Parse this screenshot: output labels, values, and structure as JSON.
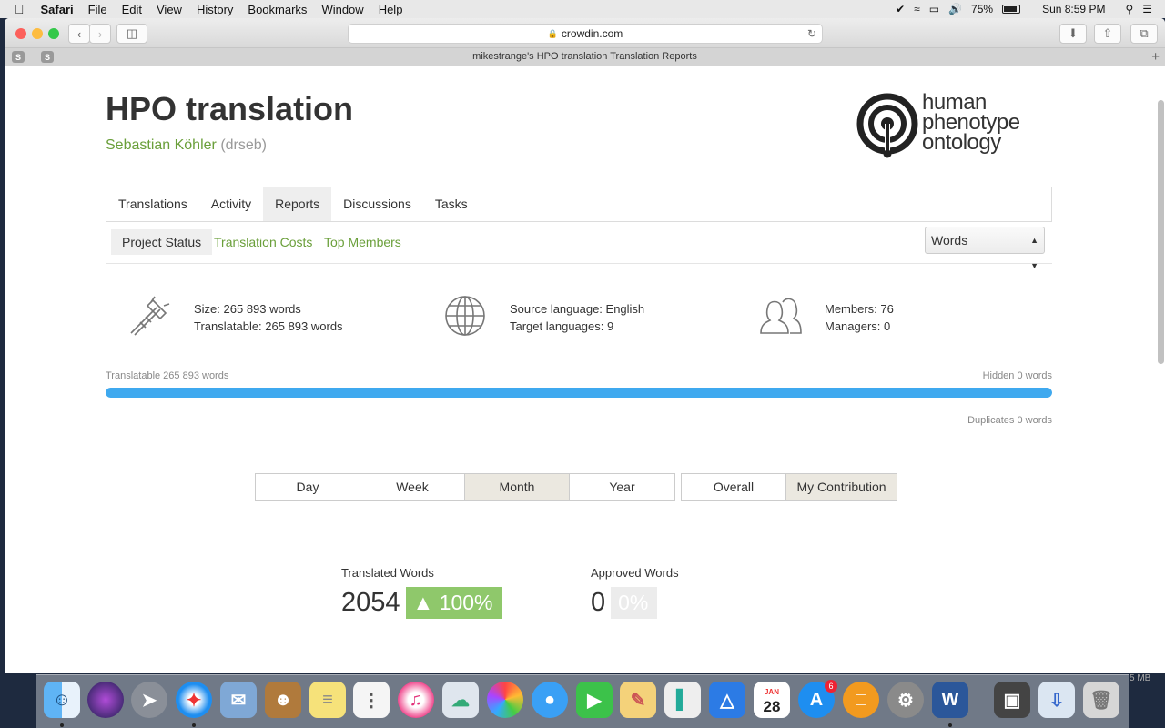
{
  "menubar": {
    "items": [
      "Safari",
      "File",
      "Edit",
      "View",
      "History",
      "Bookmarks",
      "Window",
      "Help"
    ],
    "battery": "75%",
    "clock": "Sun 8:59 PM"
  },
  "browser": {
    "address": "crowdin.com",
    "tab_title": "mikestrange's HPO translation Translation Reports",
    "pinned": [
      "S",
      "S"
    ]
  },
  "project": {
    "title": "HPO translation",
    "owner_name": "Sebastian Köhler",
    "owner_handle": "(drseb)",
    "logo_lines": [
      "human",
      "phenotype",
      "ontology"
    ]
  },
  "tabs": [
    "Translations",
    "Activity",
    "Reports",
    "Discussions",
    "Tasks"
  ],
  "active_tab": "Reports",
  "subtabs": {
    "project_status": "Project Status",
    "translation_costs": "Translation Costs",
    "top_members": "Top Members"
  },
  "unit_select": "Words",
  "stats": {
    "size": "Size: 265 893 words",
    "translatable": "Translatable: 265 893 words",
    "source": "Source language: English",
    "targets": "Target languages: 9",
    "members": "Members: 76",
    "managers": "Managers: 0"
  },
  "progress": {
    "left_label": "Translatable 265 893 words",
    "right_label": "Hidden 0 words",
    "duplicates_label": "Duplicates 0 words",
    "fraction": 1.0,
    "color": "#3fa9ef"
  },
  "period": [
    "Day",
    "Week",
    "Month",
    "Year"
  ],
  "active_period": "Month",
  "scope": [
    "Overall",
    "My Contribution"
  ],
  "active_scope": "My Contribution",
  "metrics": {
    "translated_label": "Translated Words",
    "translated_value": "2054",
    "translated_change": "▲ 100%",
    "approved_label": "Approved Words",
    "approved_value": "0",
    "approved_change": "0%"
  },
  "dock": {
    "calendar_month": "JAN",
    "calendar_day": "28",
    "appstore_badge": "6",
    "memory": "5 MB"
  },
  "colors": {
    "accent_green": "#6a9f3a",
    "badge_green": "#8fc86b",
    "progress_blue": "#3fa9ef"
  }
}
